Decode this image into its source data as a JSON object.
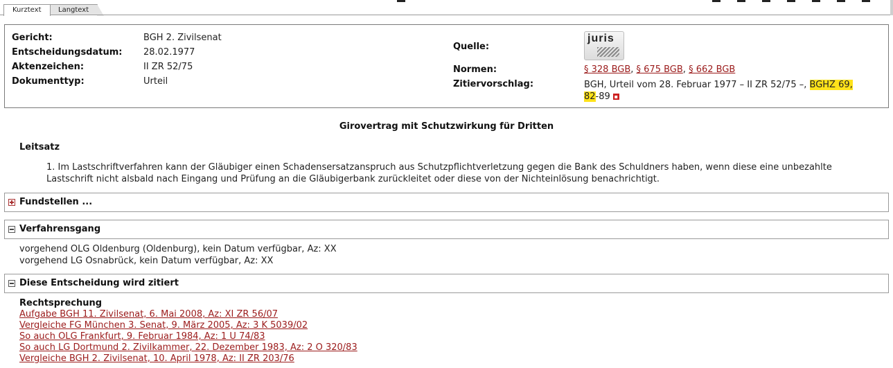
{
  "tabs": [
    {
      "label": "Kurztext",
      "active": true
    },
    {
      "label": "Langtext",
      "active": false
    }
  ],
  "info": {
    "gericht_label": "Gericht:",
    "gericht_value": "BGH 2. Zivilsenat",
    "datum_label": "Entscheidungsdatum:",
    "datum_value": "28.02.1977",
    "aktenzeichen_label": "Aktenzeichen:",
    "aktenzeichen_value": "II ZR 52/75",
    "dokumenttyp_label": "Dokumenttyp:",
    "dokumenttyp_value": "Urteil",
    "quelle_label": "Quelle:",
    "quelle_logo_text": "juris",
    "normen_label": "Normen:",
    "normen": [
      "§ 328 BGB",
      "§ 675 BGB",
      "§ 662 BGB"
    ],
    "zitier_label": "Zitiervorschlag:",
    "zitier_text_1": "BGH, Urteil vom 28. Februar 1977 – II ZR 52/75 –, ",
    "zitier_hl_1": "BGHZ 69,",
    "zitier_hl_2": "82",
    "zitier_text_2": "-89",
    "pdf_icon": "pdf-icon"
  },
  "doc": {
    "title": "Girovertrag mit Schutzwirkung für Dritten",
    "leitsatz_heading": "Leitsatz",
    "leitsatz_line_1": "1. Im Lastschriftverfahren kann der Gläubiger einen Schadensersatzanspruch aus Schutzpflichtverletzung gegen die Bank des Schuldners haben, wenn diese eine unbezahlte",
    "leitsatz_line_2": "Lastschrift nicht alsbald nach Eingang und Prüfung an die Gläubigerbank zurückleitet oder diese von der Nichteinlösung benachrichtigt."
  },
  "sections": {
    "fundstellen_title": "Fundstellen ...",
    "verfahrensgang_title": "Verfahrensgang",
    "verfahrensgang_lines": [
      "vorgehend OLG Oldenburg (Oldenburg), kein Datum verfügbar, Az: XX",
      "vorgehend LG Osnabrück, kein Datum verfügbar, Az: XX"
    ],
    "zitiert_title": "Diese Entscheidung wird zitiert",
    "rechtsprechung_heading": "Rechtsprechung",
    "rechtsprechung_links": [
      "Aufgabe BGH 11. Zivilsenat, 6. Mai 2008, Az: XI ZR 56/07",
      "Vergleiche FG München 3. Senat, 9. März 2005, Az: 3 K 5039/02",
      "So auch OLG Frankfurt, 9. Februar 1984, Az: 1 U 74/83",
      "So auch LG Dortmund 2. Zivilkammer, 22. Dezember 1983, Az: 2 O 320/83",
      "Vergleiche BGH 2. Zivilsenat, 10. April 1978, Az: II ZR 203/76"
    ]
  }
}
